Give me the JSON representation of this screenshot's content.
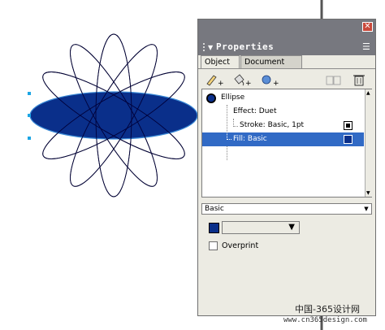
{
  "panel": {
    "title": "Properties",
    "close_glyph": "✕",
    "menu_icon": "menu-icon",
    "tabs": [
      {
        "label": "Object",
        "active": true
      },
      {
        "label": "Document",
        "active": false
      }
    ]
  },
  "toolbar": {
    "add_stroke_icon": "pen-plus-icon",
    "add_fill_icon": "bucket-plus-icon",
    "add_effect_icon": "sphere-plus-icon",
    "duplicate_icon": "duplicate-icon",
    "delete_icon": "trash-icon"
  },
  "attributes": {
    "object_name": "Ellipse",
    "effect": "Effect: Duet",
    "stroke": "Stroke: Basic, 1pt",
    "fill": "Fill: Basic",
    "stroke_color": "#000000",
    "fill_color": "#0a2f8a",
    "selected_row": "fill"
  },
  "fill_options": {
    "type": "Basic",
    "color": "#0a2f8a",
    "overprint_label": "Overprint",
    "overprint_checked": false
  },
  "colors": {
    "selection": "#316ac5",
    "panel_bg": "#ecebe3",
    "titlebar": "#77787f"
  },
  "watermark": {
    "line1": "中国-365设计网",
    "line2": "www.cn365design.com"
  }
}
